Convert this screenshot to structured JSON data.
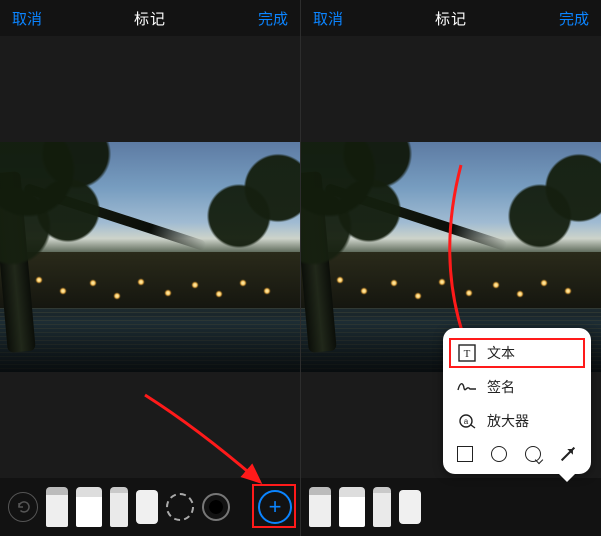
{
  "left": {
    "header": {
      "cancel": "取消",
      "title": "标记",
      "done": "完成"
    },
    "toolbar": {
      "undo_icon": "undo-icon",
      "tools": [
        "pen",
        "marker",
        "pencil",
        "eraser"
      ],
      "lasso_icon": "lasso-icon",
      "color_icon": "color-picker-icon",
      "plus_icon": "plus-icon"
    }
  },
  "right": {
    "header": {
      "cancel": "取消",
      "title": "标记",
      "done": "完成"
    },
    "toolbar": {
      "tools": [
        "pen",
        "marker",
        "pencil",
        "eraser"
      ]
    },
    "popover": {
      "items": [
        {
          "icon": "text-icon",
          "label": "文本"
        },
        {
          "icon": "signature-icon",
          "label": "签名"
        },
        {
          "icon": "magnifier-icon",
          "label": "放大器"
        }
      ],
      "shape_icons": [
        "square-icon",
        "circle-icon",
        "speech-bubble-icon",
        "arrow-icon"
      ]
    }
  },
  "annotations": {
    "highlight_plus": "red-highlight-box",
    "highlight_text_row": "red-highlight-box",
    "arrow_to_plus": "red-arrow",
    "arrow_to_text": "red-arrow"
  }
}
